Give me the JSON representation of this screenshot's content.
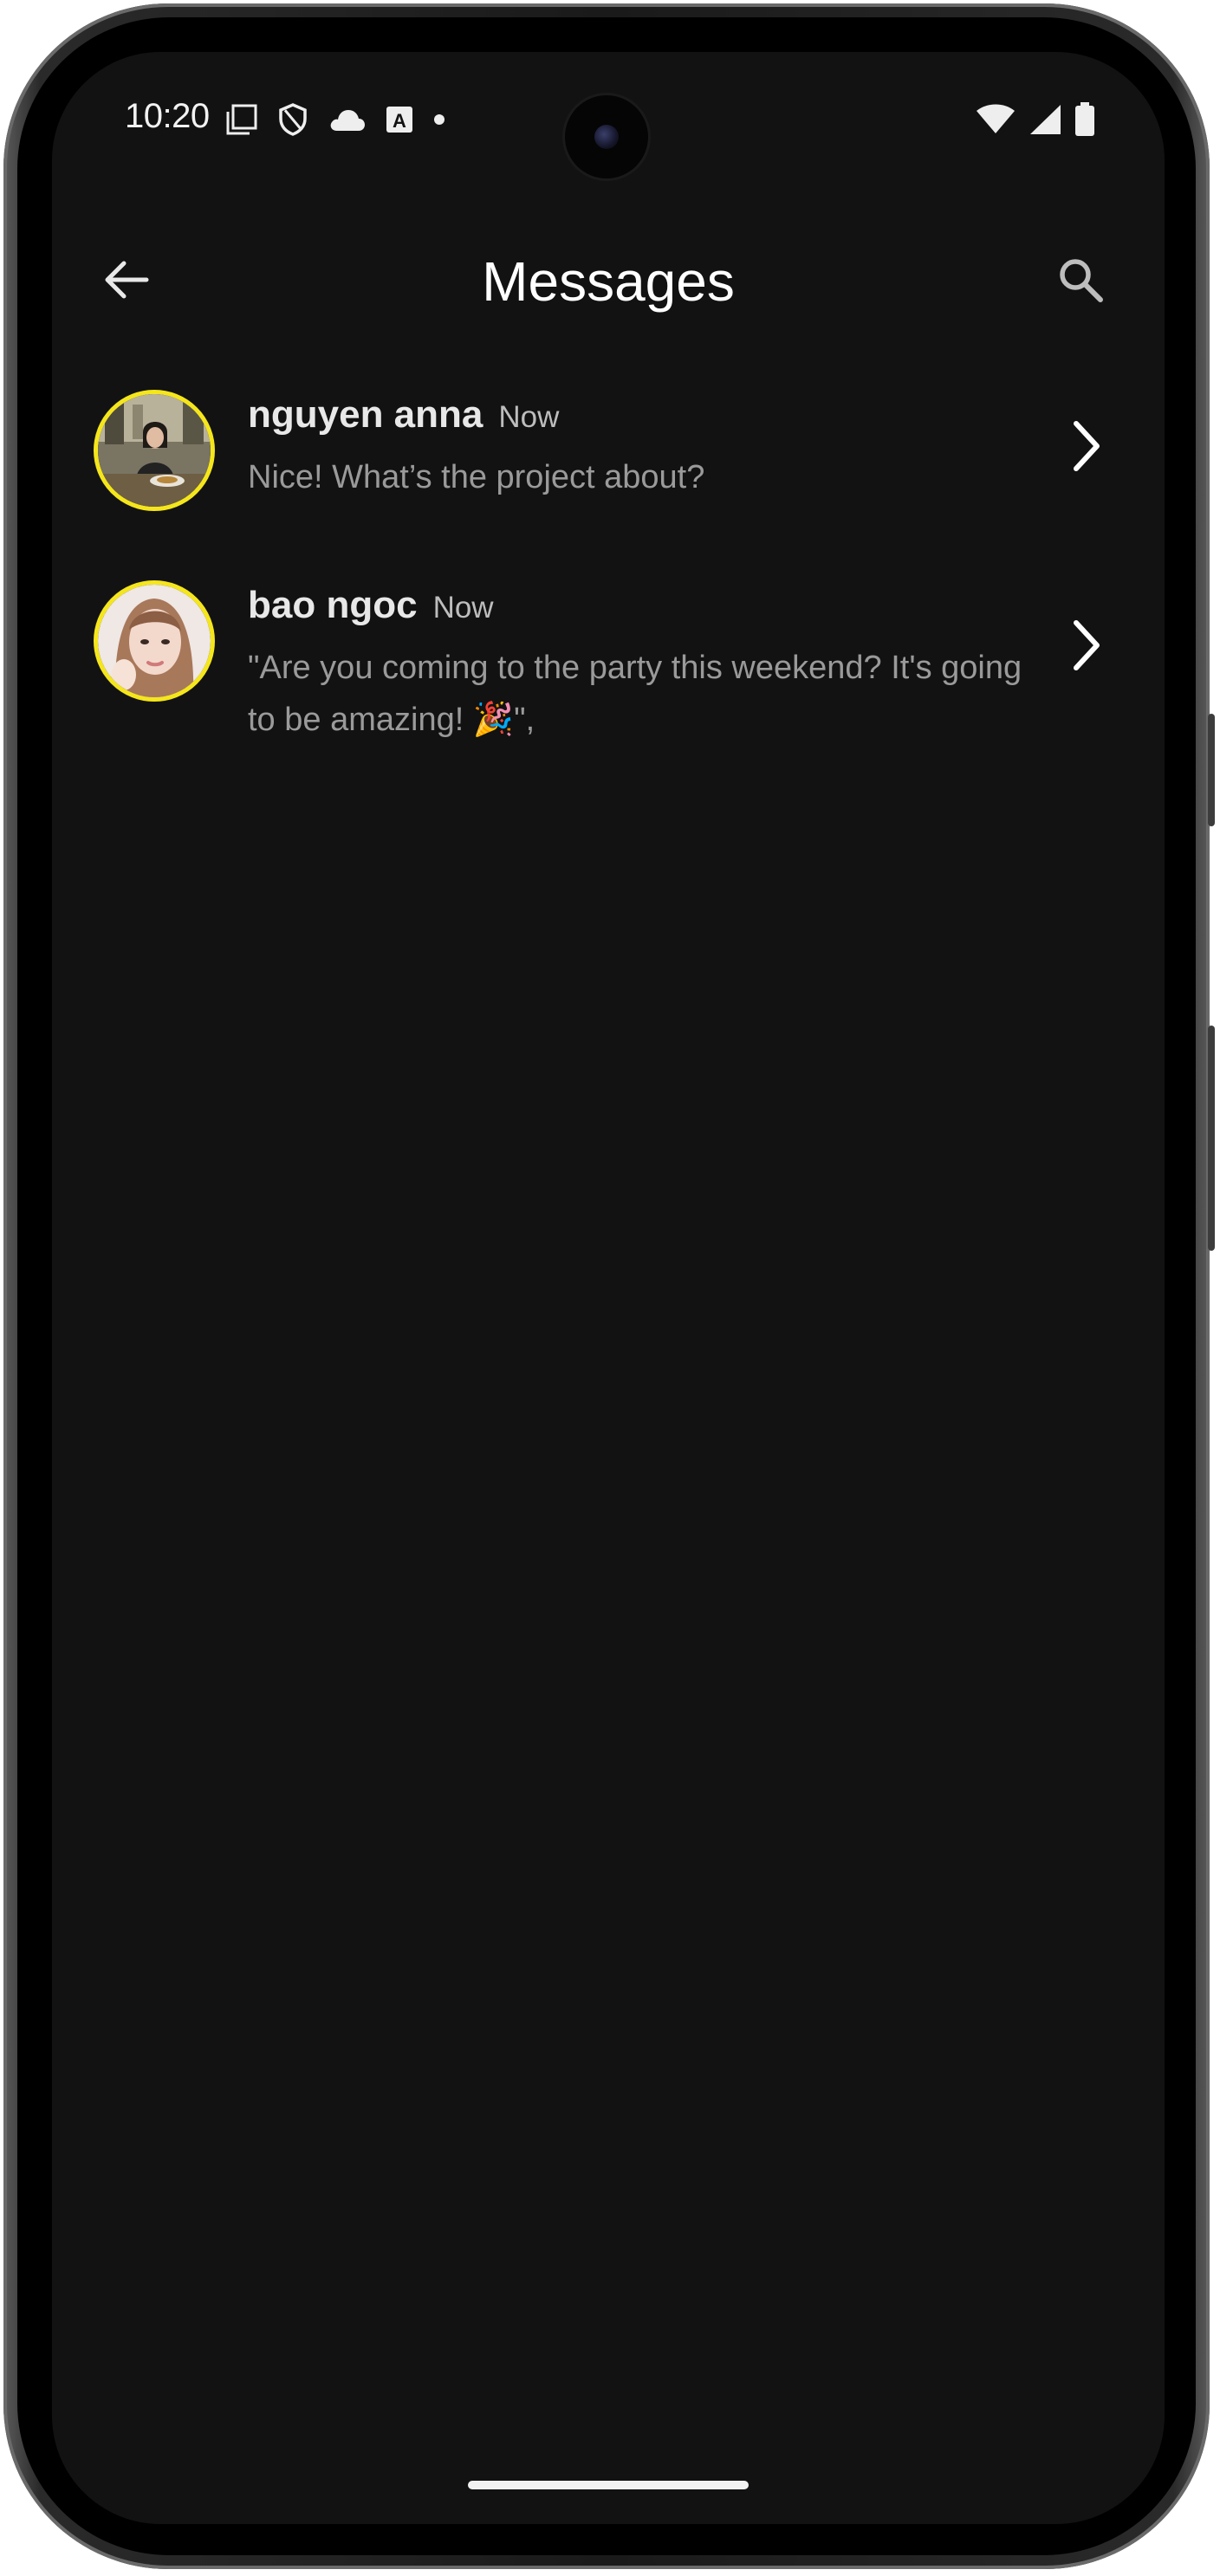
{
  "status_bar": {
    "time": "10:20",
    "left_icons": [
      "screenshot-icon",
      "shield-icon",
      "cloud-icon",
      "a-box-icon",
      "dot-icon"
    ],
    "right_icons": [
      "wifi-icon",
      "signal-icon",
      "battery-icon"
    ]
  },
  "app_bar": {
    "title": "Messages",
    "back_icon": "arrow-left-icon",
    "search_icon": "search-icon"
  },
  "conversations": [
    {
      "name": "nguyen anna",
      "time": "Now",
      "preview": "Nice! What’s the project about?"
    },
    {
      "name": "bao ngoc",
      "time": "Now",
      "preview": "\"Are you coming to the party this weekend? It's going to be amazing! 🎉\","
    }
  ],
  "colors": {
    "background": "#121212",
    "avatar_ring": "#f5e61c",
    "title": "#ffffff",
    "name": "#e8e8e8",
    "preview": "#9a9a9a"
  }
}
